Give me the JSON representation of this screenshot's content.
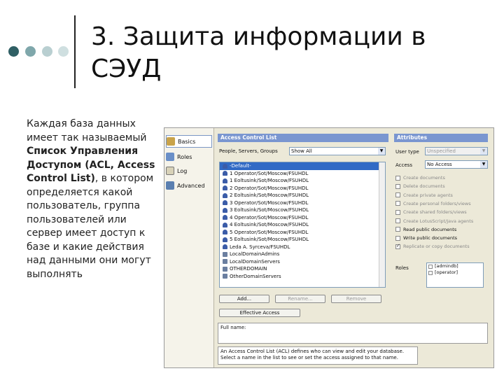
{
  "slide": {
    "title": "3. Защита информации в СЭУД",
    "body_part1": "Каждая база данных имеет так называемый ",
    "body_bold": "Список Управления Доступом (ACL, Access Control List)",
    "body_part2": ", в котором определяется какой пользователь, группа пользователей или сервер имеет доступ к базе и какие действия над данными они могут выполнять"
  },
  "nav": {
    "items": [
      {
        "label": "Basics",
        "icon": "key-icon"
      },
      {
        "label": "Roles",
        "icon": "roles-icon"
      },
      {
        "label": "Log",
        "icon": "log-icon"
      },
      {
        "label": "Advanced",
        "icon": "advanced-icon"
      }
    ]
  },
  "acl": {
    "header": "Access Control List",
    "filter_label": "People, Servers, Groups",
    "filter_value": "Show All",
    "entries": [
      "-Default-",
      "1 Operator/Sot/Moscow/FSUHDL",
      "1 Eoltusink/Sot/Moscow/FSUHDL",
      "2 Operator/Sot/Moscow/FSUHDL",
      "2 Eoltusink/Sot/Moscow/FSUHDL",
      "3 Operator/Sot/Moscow/FSUHDL",
      "3 Eoltusink/Sot/Moscow/FSUHDL",
      "4 Operator/Sot/Moscow/FSUHDL",
      "4 Eoltusink/Sot/Moscow/FSUHDL",
      "5 Operator/Sot/Moscow/FSUHDL",
      "5 Eoltusink/Sot/Moscow/FSUHDL",
      "Leda A. Syrceva/FSUHDL",
      "LocalDomainAdmins",
      "LocalDomainServers",
      "OTHERDOMAIN",
      "OtherDomainServers"
    ],
    "buttons": {
      "add": "Add...",
      "rename": "Rename...",
      "remove": "Remove",
      "effective": "Effective Access"
    },
    "fullname_label": "Full name:",
    "description": "An Access Control List (ACL) defines who can view and edit your database. Select a name in the list to see or set the access assigned to that name."
  },
  "attributes": {
    "header": "Attributes",
    "user_type_label": "User type",
    "user_type_value": "Unspecified",
    "access_label": "Access",
    "access_value": "No Access",
    "checkboxes": [
      {
        "label": "Create documents",
        "checked": false,
        "enabled": false
      },
      {
        "label": "Delete documents",
        "checked": false,
        "enabled": false
      },
      {
        "label": "Create private agents",
        "checked": false,
        "enabled": false
      },
      {
        "label": "Create personal folders/views",
        "checked": false,
        "enabled": false
      },
      {
        "label": "Create shared folders/views",
        "checked": false,
        "enabled": false
      },
      {
        "label": "Create LotusScript/Java agents",
        "checked": false,
        "enabled": false
      },
      {
        "label": "Read public documents",
        "checked": false,
        "enabled": true
      },
      {
        "label": "Write public documents",
        "checked": false,
        "enabled": true
      },
      {
        "label": "Replicate or copy documents",
        "checked": true,
        "enabled": false
      }
    ],
    "roles_label": "Roles",
    "roles": [
      "[admindb]",
      "[operator]"
    ]
  }
}
